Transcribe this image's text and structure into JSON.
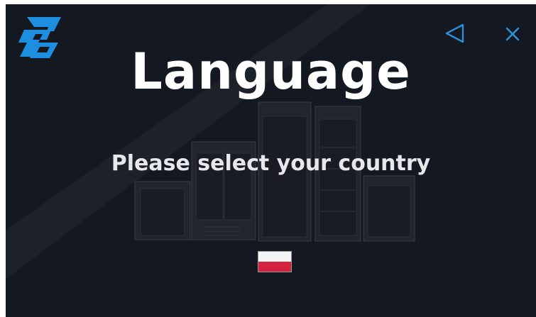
{
  "screen": {
    "title": "Language",
    "subtitle": "Please select your country"
  },
  "icons": {
    "logo": "brand-logo",
    "back": "back-triangle-icon",
    "close": "close-icon"
  },
  "countries": [
    {
      "name": "poland-flag",
      "colors": [
        "#f4f4f4",
        "#d4213d"
      ]
    }
  ],
  "colors": {
    "background": "#141821",
    "accent": "#2c8fd8",
    "text": "#ffffff"
  }
}
